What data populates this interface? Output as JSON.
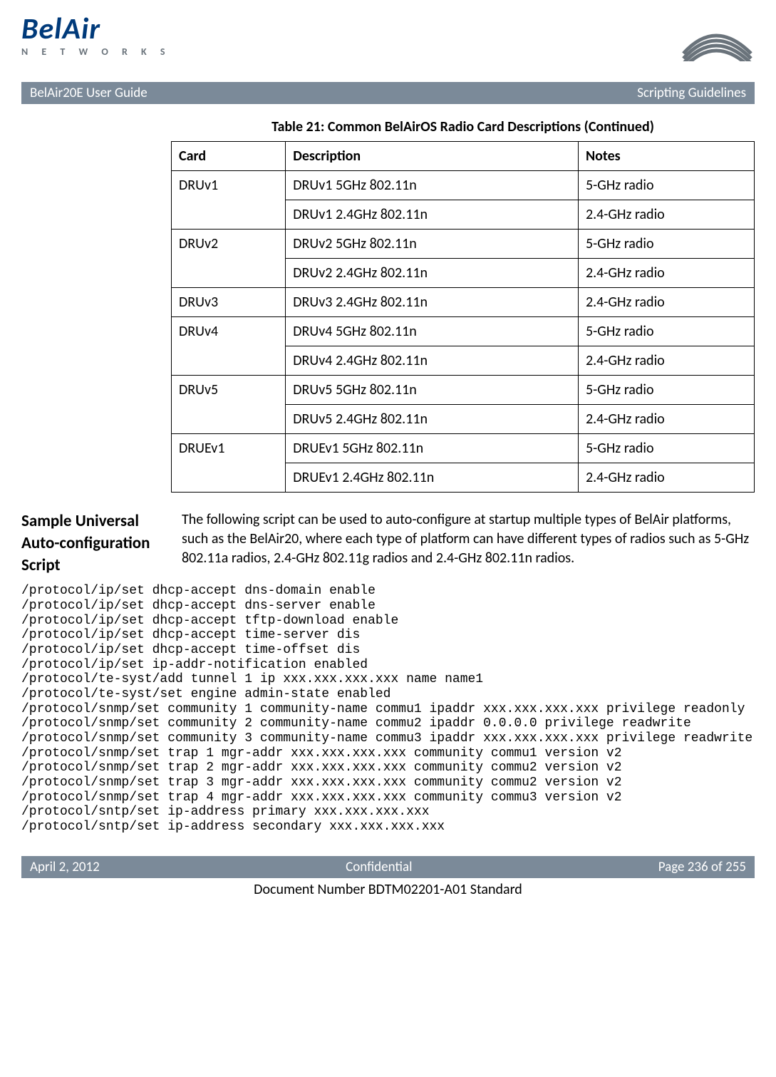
{
  "header": {
    "logo_main": "BelAir",
    "logo_sub": "N E T W O R K S",
    "bar_left": "BelAir20E User Guide",
    "bar_right": "Scripting Guidelines"
  },
  "table": {
    "title": "Table 21: Common BelAirOS Radio Card Descriptions  (Continued)",
    "headers": {
      "card": "Card",
      "description": "Description",
      "notes": "Notes"
    },
    "rows": {
      "druv1_card": "DRUv1",
      "druv1_d1": "DRUv1 5GHz 802.11n",
      "druv1_n1": "5-GHz radio",
      "druv1_d2": "DRUv1 2.4GHz 802.11n",
      "druv1_n2": "2.4-GHz radio",
      "druv2_card": "DRUv2",
      "druv2_d1": "DRUv2 5GHz 802.11n",
      "druv2_n1": "5-GHz radio",
      "druv2_d2": "DRUv2 2.4GHz 802.11n",
      "druv2_n2": "2.4-GHz radio",
      "druv3_card": "DRUv3",
      "druv3_d1": "DRUv3 2.4GHz 802.11n",
      "druv3_n1": "2.4-GHz radio",
      "druv4_card": "DRUv4",
      "druv4_d1": "DRUv4 5GHz 802.11n",
      "druv4_n1": "5-GHz radio",
      "druv4_d2": "DRUv4 2.4GHz 802.11n",
      "druv4_n2": "2.4-GHz radio",
      "druv5_card": "DRUv5",
      "druv5_d1": "DRUv5 5GHz 802.11n",
      "druv5_n1": "5-GHz radio",
      "druv5_d2": "DRUv5 2.4GHz 802.11n",
      "druv5_n2": "2.4-GHz radio",
      "druev1_card": "DRUEv1",
      "druev1_d1": "DRUEv1 5GHz 802.11n",
      "druev1_n1": "5-GHz radio",
      "druev1_d2": "DRUEv1 2.4GHz 802.11n",
      "druev1_n2": "2.4-GHz radio"
    }
  },
  "section": {
    "heading": "Sample Universal Auto-configuration Script",
    "para": "The following script can be used to auto-configure at startup multiple types of BelAir platforms, such as the BelAir20, where each type of platform can have different types of radios such as 5-GHz 802.11a radios, 2.4-GHz 802.11g radios and 2.4-GHz 802.11n radios."
  },
  "code": "/protocol/ip/set dhcp-accept dns-domain enable\n/protocol/ip/set dhcp-accept dns-server enable\n/protocol/ip/set dhcp-accept tftp-download enable\n/protocol/ip/set dhcp-accept time-server dis\n/protocol/ip/set dhcp-accept time-offset dis\n/protocol/ip/set ip-addr-notification enabled\n/protocol/te-syst/add tunnel 1 ip xxx.xxx.xxx.xxx name name1\n/protocol/te-syst/set engine admin-state enabled\n/protocol/snmp/set community 1 community-name commu1 ipaddr xxx.xxx.xxx.xxx privilege readonly\n/protocol/snmp/set community 2 community-name commu2 ipaddr 0.0.0.0 privilege readwrite\n/protocol/snmp/set community 3 community-name commu3 ipaddr xxx.xxx.xxx.xxx privilege readwrite\n/protocol/snmp/set trap 1 mgr-addr xxx.xxx.xxx.xxx community commu1 version v2\n/protocol/snmp/set trap 2 mgr-addr xxx.xxx.xxx.xxx community commu2 version v2\n/protocol/snmp/set trap 3 mgr-addr xxx.xxx.xxx.xxx community commu2 version v2\n/protocol/snmp/set trap 4 mgr-addr xxx.xxx.xxx.xxx community commu3 version v2\n/protocol/sntp/set ip-address primary xxx.xxx.xxx.xxx\n/protocol/sntp/set ip-address secondary xxx.xxx.xxx.xxx",
  "footer": {
    "left": "April 2, 2012",
    "center": "Confidential",
    "right": "Page 236 of 255",
    "docnum": "Document Number BDTM02201-A01 Standard"
  }
}
